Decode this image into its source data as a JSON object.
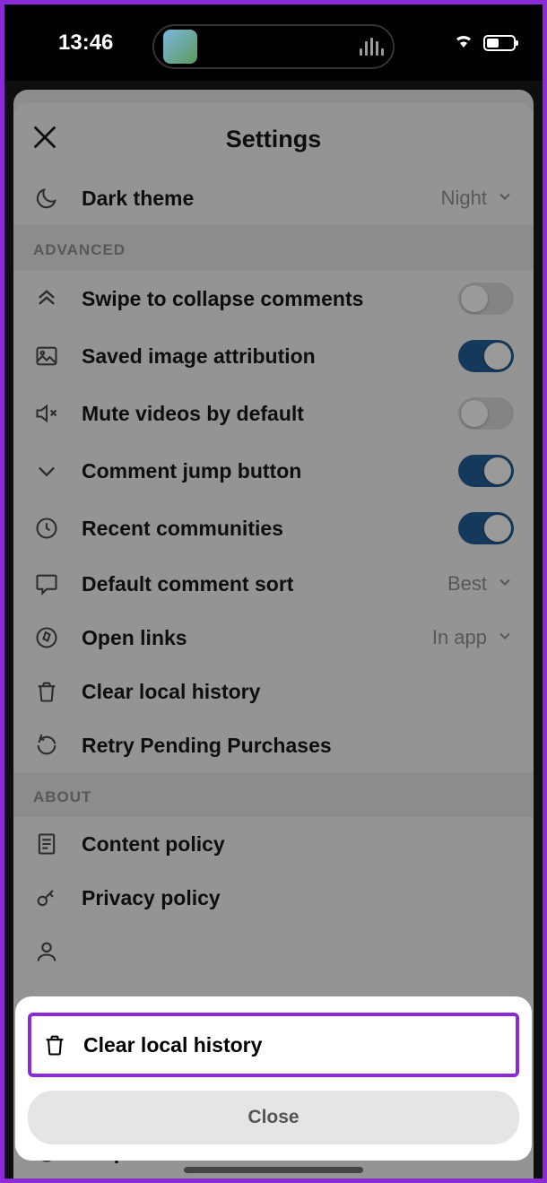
{
  "status": {
    "time": "13:46"
  },
  "header": {
    "title": "Settings"
  },
  "theme": {
    "label": "Dark theme",
    "value": "Night"
  },
  "sections": {
    "advanced": {
      "title": "ADVANCED",
      "items": [
        {
          "label": "Swipe to collapse comments",
          "type": "toggle",
          "on": false
        },
        {
          "label": "Saved image attribution",
          "type": "toggle",
          "on": true
        },
        {
          "label": "Mute videos by default",
          "type": "toggle",
          "on": false
        },
        {
          "label": "Comment jump button",
          "type": "toggle",
          "on": true
        },
        {
          "label": "Recent communities",
          "type": "toggle",
          "on": true
        },
        {
          "label": "Default comment sort",
          "type": "value",
          "value": "Best"
        },
        {
          "label": "Open links",
          "type": "value",
          "value": "In app"
        },
        {
          "label": "Clear local history",
          "type": "action"
        },
        {
          "label": "Retry Pending Purchases",
          "type": "action"
        }
      ]
    },
    "about": {
      "title": "ABOUT",
      "items": [
        {
          "label": "Content policy"
        },
        {
          "label": "Privacy policy"
        }
      ]
    }
  },
  "bottom_row": {
    "label": "Help Center"
  },
  "action_sheet": {
    "primary": "Clear local history",
    "close": "Close"
  }
}
